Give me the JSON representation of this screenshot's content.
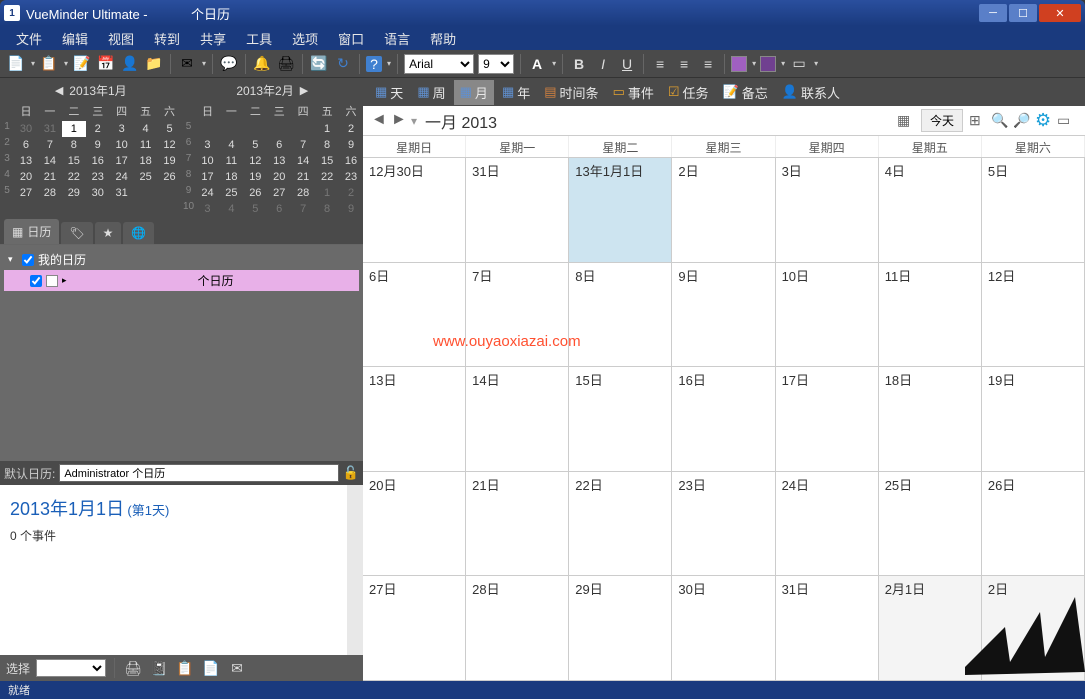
{
  "title": "VueMinder Ultimate - ",
  "title_suffix": "个日历",
  "menu": [
    "文件",
    "编辑",
    "视图",
    "转到",
    "共享",
    "工具",
    "选项",
    "窗口",
    "语言",
    "帮助"
  ],
  "font_name": "Arial",
  "font_size": "9",
  "minicals": [
    {
      "title": "2013年1月",
      "dow": [
        "日",
        "一",
        "二",
        "三",
        "四",
        "五",
        "六"
      ],
      "weeks": [
        {
          "num": "1",
          "days": [
            {
              "d": "30",
              "dim": true
            },
            {
              "d": "31",
              "dim": true
            },
            {
              "d": "1",
              "sel": true
            },
            {
              "d": "2"
            },
            {
              "d": "3"
            },
            {
              "d": "4"
            },
            {
              "d": "5"
            }
          ]
        },
        {
          "num": "2",
          "days": [
            {
              "d": "6"
            },
            {
              "d": "7"
            },
            {
              "d": "8"
            },
            {
              "d": "9"
            },
            {
              "d": "10"
            },
            {
              "d": "11"
            },
            {
              "d": "12"
            }
          ]
        },
        {
          "num": "3",
          "days": [
            {
              "d": "13"
            },
            {
              "d": "14"
            },
            {
              "d": "15"
            },
            {
              "d": "16"
            },
            {
              "d": "17"
            },
            {
              "d": "18"
            },
            {
              "d": "19"
            }
          ]
        },
        {
          "num": "4",
          "days": [
            {
              "d": "20"
            },
            {
              "d": "21"
            },
            {
              "d": "22"
            },
            {
              "d": "23"
            },
            {
              "d": "24"
            },
            {
              "d": "25"
            },
            {
              "d": "26"
            }
          ]
        },
        {
          "num": "5",
          "days": [
            {
              "d": "27"
            },
            {
              "d": "28"
            },
            {
              "d": "29"
            },
            {
              "d": "30"
            },
            {
              "d": "31"
            },
            {
              "d": "",
              "dim": true
            },
            {
              "d": "",
              "dim": true
            }
          ]
        }
      ]
    },
    {
      "title": "2013年2月",
      "dow": [
        "日",
        "一",
        "二",
        "三",
        "四",
        "五",
        "六"
      ],
      "weeks": [
        {
          "num": "5",
          "days": [
            {
              "d": "",
              "dim": true
            },
            {
              "d": "",
              "dim": true
            },
            {
              "d": "",
              "dim": true
            },
            {
              "d": "",
              "dim": true
            },
            {
              "d": "",
              "dim": true
            },
            {
              "d": "1"
            },
            {
              "d": "2"
            }
          ]
        },
        {
          "num": "6",
          "days": [
            {
              "d": "3"
            },
            {
              "d": "4"
            },
            {
              "d": "5"
            },
            {
              "d": "6"
            },
            {
              "d": "7"
            },
            {
              "d": "8"
            },
            {
              "d": "9"
            }
          ]
        },
        {
          "num": "7",
          "days": [
            {
              "d": "10"
            },
            {
              "d": "11"
            },
            {
              "d": "12"
            },
            {
              "d": "13"
            },
            {
              "d": "14"
            },
            {
              "d": "15"
            },
            {
              "d": "16"
            }
          ]
        },
        {
          "num": "8",
          "days": [
            {
              "d": "17"
            },
            {
              "d": "18"
            },
            {
              "d": "19"
            },
            {
              "d": "20"
            },
            {
              "d": "21"
            },
            {
              "d": "22"
            },
            {
              "d": "23"
            }
          ]
        },
        {
          "num": "9",
          "days": [
            {
              "d": "24"
            },
            {
              "d": "25"
            },
            {
              "d": "26"
            },
            {
              "d": "27"
            },
            {
              "d": "28"
            },
            {
              "d": "1",
              "dim": true
            },
            {
              "d": "2",
              "dim": true
            }
          ]
        },
        {
          "num": "10",
          "days": [
            {
              "d": "3",
              "dim": true
            },
            {
              "d": "4",
              "dim": true
            },
            {
              "d": "5",
              "dim": true
            },
            {
              "d": "6",
              "dim": true
            },
            {
              "d": "7",
              "dim": true
            },
            {
              "d": "8",
              "dim": true
            },
            {
              "d": "9",
              "dim": true
            }
          ]
        }
      ]
    }
  ],
  "sidebar_tabs": {
    "calendar": "日历"
  },
  "tree": {
    "root": "我的日历",
    "child": "个日历"
  },
  "defcal_label": "默认日历:",
  "defcal_value": "Administrator 个日历",
  "details": {
    "date": "2013年1月1日",
    "daynum": "(第1天)",
    "events": "0 个事件"
  },
  "selbar_label": "选择",
  "viewbar": {
    "day": "天",
    "week": "周",
    "month": "月",
    "year": "年",
    "timeline": "时间条",
    "event": "事件",
    "task": "任务",
    "note": "备忘",
    "contact": "联系人"
  },
  "calheader": {
    "title": "一月 2013",
    "today": "今天"
  },
  "dow": [
    "星期日",
    "星期一",
    "星期二",
    "星期三",
    "星期四",
    "星期五",
    "星期六"
  ],
  "grid": [
    [
      {
        "l": "12月30日",
        "dim": false
      },
      {
        "l": "31日"
      },
      {
        "l": "13年1月1日",
        "today": true
      },
      {
        "l": "2日"
      },
      {
        "l": "3日"
      },
      {
        "l": "4日"
      },
      {
        "l": "5日"
      }
    ],
    [
      {
        "l": "6日"
      },
      {
        "l": "7日"
      },
      {
        "l": "8日"
      },
      {
        "l": "9日"
      },
      {
        "l": "10日"
      },
      {
        "l": "11日"
      },
      {
        "l": "12日"
      }
    ],
    [
      {
        "l": "13日"
      },
      {
        "l": "14日"
      },
      {
        "l": "15日"
      },
      {
        "l": "16日"
      },
      {
        "l": "17日"
      },
      {
        "l": "18日"
      },
      {
        "l": "19日"
      }
    ],
    [
      {
        "l": "20日"
      },
      {
        "l": "21日"
      },
      {
        "l": "22日"
      },
      {
        "l": "23日"
      },
      {
        "l": "24日"
      },
      {
        "l": "25日"
      },
      {
        "l": "26日"
      }
    ],
    [
      {
        "l": "27日"
      },
      {
        "l": "28日"
      },
      {
        "l": "29日"
      },
      {
        "l": "30日"
      },
      {
        "l": "31日"
      },
      {
        "l": "2月1日",
        "dim": true
      },
      {
        "l": "2日",
        "dim": true
      }
    ]
  ],
  "watermark": "www.ouyaoxiazai.com",
  "status": "就绪"
}
